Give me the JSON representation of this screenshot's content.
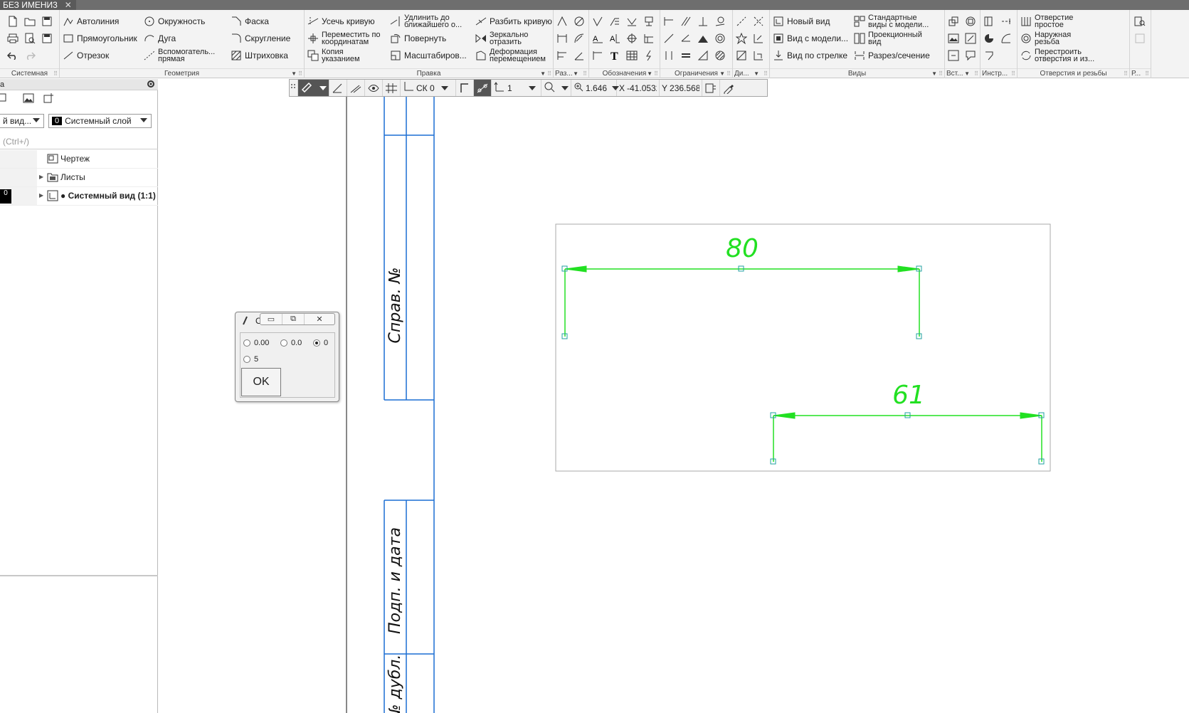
{
  "document_tab": {
    "title": "БЕЗ ИМЕНИ3",
    "close": "✕"
  },
  "ribbon": {
    "groups": {
      "system": "Системная",
      "geometry": "Геометрия",
      "edit": "Правка",
      "dimensions": "Раз...",
      "annotations": "Обозначения",
      "constraints": "Ограничения",
      "di": "Ди...",
      "views": "Виды",
      "insert": "Вст...",
      "tools": "Инстр...",
      "holes": "Отверстия и резьбы",
      "r": "Р..."
    },
    "geometry": {
      "autoline": "Автолиния",
      "rectangle": "Прямоугольник",
      "segment": "Отрезок",
      "circle": "Окружность",
      "arc": "Дуга",
      "auxline": "Вспомогатель...\nпрямая",
      "chamfer": "Фаска",
      "fillet": "Скругление",
      "hatch": "Штриховка"
    },
    "edit": {
      "trim": "Усечь кривую",
      "move_coords": "Переместить по\nкоординатам",
      "copy": "Копия\nуказанием",
      "extend": "Удлинить до\nближайшего о...",
      "rotate": "Повернуть",
      "scale": "Масштабиров...",
      "split": "Разбить кривую",
      "mirror": "Зеркально\nотразить",
      "deform": "Деформация\nперемещением"
    },
    "views": {
      "new_view": "Новый вид",
      "model_view": "Вид с модели...",
      "arrow_view": "Вид по стрелке",
      "standard_views": "Стандартные\nвиды с модели...",
      "projection": "Проекционный\nвид",
      "section": "Разрез/сечение"
    },
    "holes": {
      "simple": "Отверстие\nпростое",
      "external_thread": "Наружная\nрезьба",
      "rebuild": "Перестроить\nотверстия и из..."
    }
  },
  "left_panel": {
    "header": "а",
    "view_combo": "й вид...",
    "layer_number": "0",
    "layer_combo": "Системный слой",
    "search_placeholder": "(Ctrl+/)",
    "tree": [
      {
        "label": "Чертеж",
        "bold": false
      },
      {
        "label": "Листы",
        "bold": false
      },
      {
        "label": "● Системный вид (1:1)",
        "bold": true,
        "badge": "0"
      }
    ]
  },
  "float_toolbar": {
    "cs": "СК 0",
    "step": "1",
    "zoom": "1.646",
    "x_label": "X",
    "x_value": "-41.0532",
    "y_label": "Y",
    "y_value": "236.5680"
  },
  "dialog": {
    "title": "О",
    "options": [
      "0.00",
      "0.0",
      "0",
      "5"
    ],
    "selected": "0",
    "ok": "OK"
  },
  "drawing": {
    "stamp_labels": [
      "Справ. №",
      "Подп. и дата",
      "№ дубл."
    ],
    "dimensions": [
      {
        "value": "80"
      },
      {
        "value": "61"
      }
    ],
    "colors": {
      "frame": "#1c6fd4",
      "dimension": "#22e022",
      "point": "#22a0a0"
    }
  }
}
